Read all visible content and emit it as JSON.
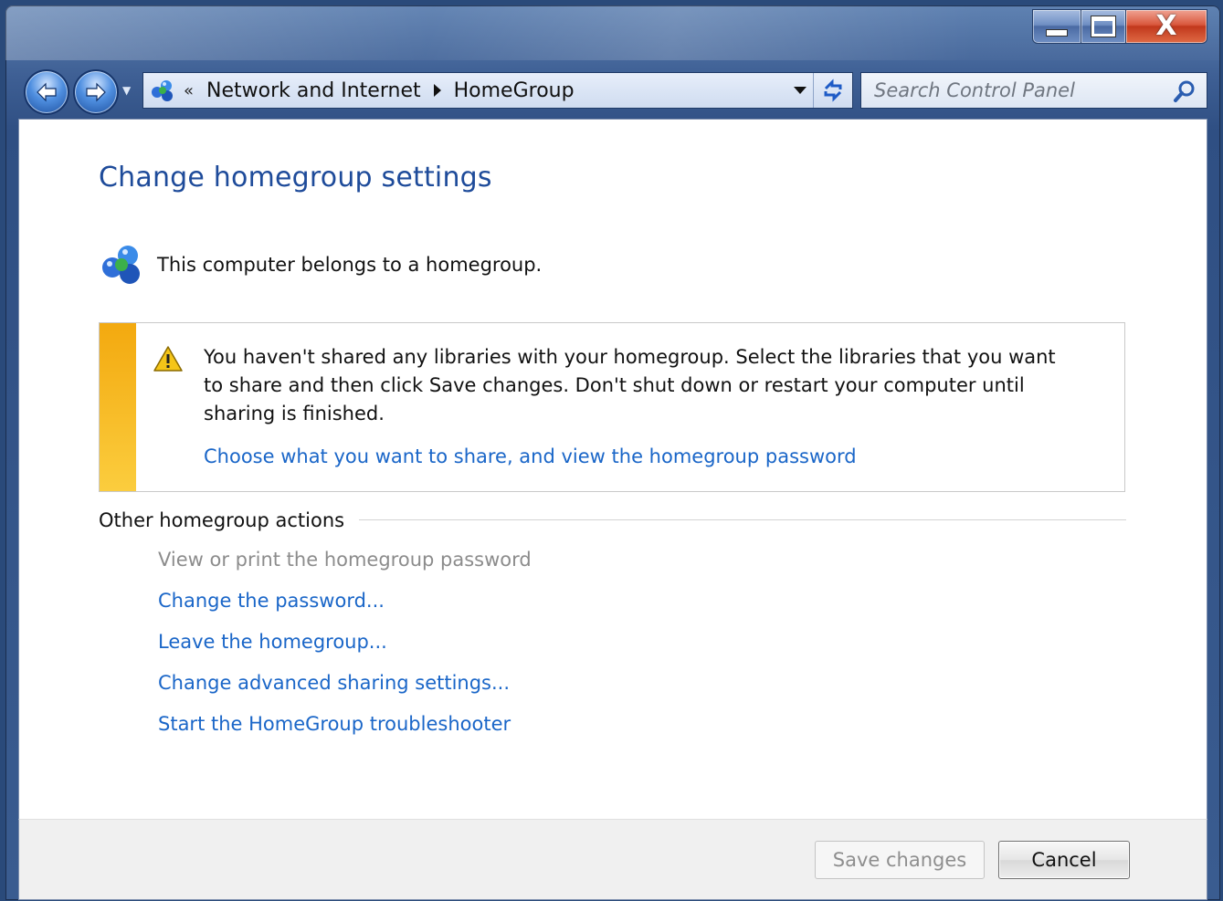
{
  "window": {
    "caption": {
      "minimize_icon": "minimize-icon",
      "maximize_icon": "maximize-icon",
      "close_glyph": "X"
    }
  },
  "navbar": {
    "back_icon": "back-arrow-icon",
    "forward_icon": "forward-arrow-icon",
    "address": {
      "overflow_chevron": "«",
      "breadcrumbs": [
        "Network and Internet",
        "HomeGroup"
      ]
    },
    "search": {
      "placeholder": "Search Control Panel"
    }
  },
  "main": {
    "title": "Change homegroup settings",
    "status_text": "This computer belongs to a homegroup.",
    "notice": {
      "message": "You haven't shared any libraries with your homegroup. Select the libraries that you want to share and then click Save changes. Don't shut down or restart your computer until sharing is finished.",
      "link": "Choose what you want to share, and view the homegroup password"
    },
    "other_actions": {
      "heading": "Other homegroup actions",
      "items": [
        "View or print the homegroup password",
        "Change the password...",
        "Leave the homegroup...",
        "Change advanced sharing settings...",
        "Start the HomeGroup troubleshooter"
      ]
    }
  },
  "footer": {
    "save_label": "Save changes",
    "cancel_label": "Cancel"
  },
  "colors": {
    "title_blue": "#1e4b9a",
    "link_blue": "#1a66c8",
    "warning_bar": "#f3a90f",
    "disabled_text": "#8c8c8c"
  }
}
